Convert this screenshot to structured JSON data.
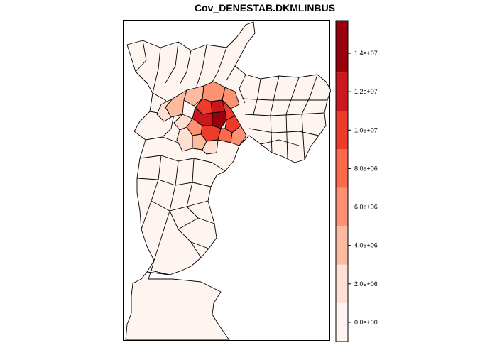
{
  "title": "Cov_DENESTAB.DKMLINBUS",
  "palette": [
    "#fff5f0",
    "#fee0d2",
    "#fcbba1",
    "#fc9272",
    "#fb6a4a",
    "#ef3b2c",
    "#cb181d",
    "#99000d"
  ],
  "legend": {
    "range": [
      -1000000,
      15700000
    ],
    "bin_edges": [
      -1000000,
      1000000,
      3000000,
      5000000,
      7000000,
      9000000,
      11000000,
      13000000,
      15700000
    ],
    "ticks": [
      {
        "value": 0,
        "label": "0.0e+00"
      },
      {
        "value": 2000000,
        "label": "2.0e+06"
      },
      {
        "value": 4000000,
        "label": "4.0e+06"
      },
      {
        "value": 6000000,
        "label": "6.0e+06"
      },
      {
        "value": 8000000,
        "label": "8.0e+06"
      },
      {
        "value": 10000000,
        "label": "1.0e+07"
      },
      {
        "value": 12000000,
        "label": "1.2e+07"
      },
      {
        "value": 14000000,
        "label": "1.4e+07"
      }
    ]
  }
}
